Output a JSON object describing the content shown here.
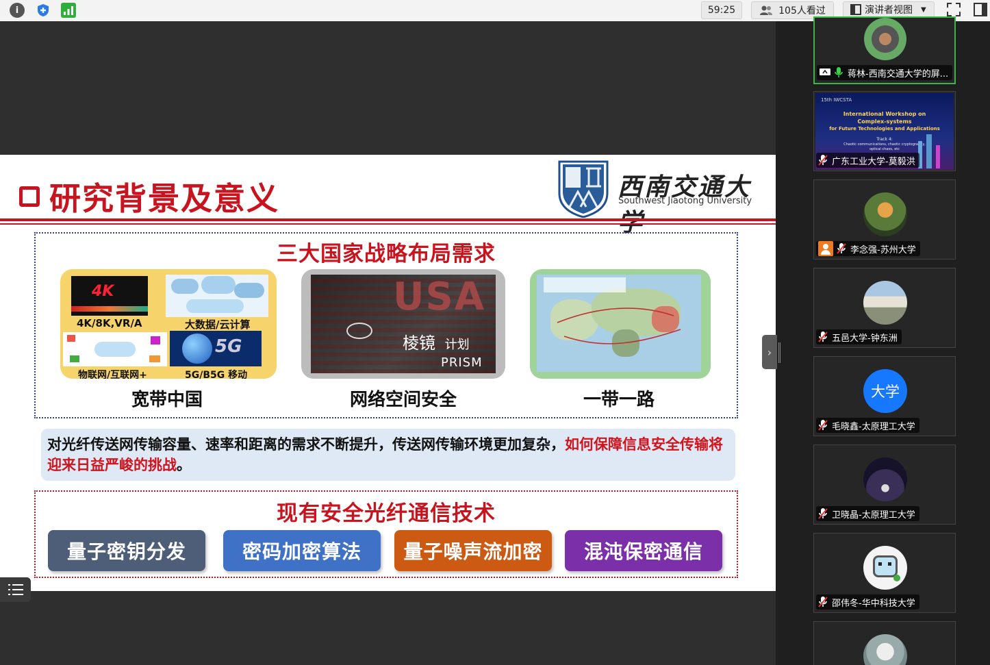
{
  "topbar": {
    "timer": "59:25",
    "viewers": "105人看过",
    "view_mode": "演讲者视图"
  },
  "slide": {
    "title": "研究背景及意义",
    "university_cn": "西南交通大学",
    "university_en": "Southwest Jiaotong University",
    "section1_heading": "三大国家战略布局需求",
    "cards": [
      {
        "label": "宽带中国",
        "sub_labels": [
          "4K/8K,VR/A",
          "大数据/云计算",
          "物联网/互联网+",
          "5G/B5G 移动"
        ]
      },
      {
        "label": "网络空间安全",
        "sub_labels": [
          "USA",
          "棱镜",
          "计划",
          "PRISM"
        ]
      },
      {
        "label": "一带一路"
      }
    ],
    "note_plain": "对光纤传送网传输容量、速率和距离的需求不断提升，传送网传输环境更加复杂，",
    "note_highlight": "如何保障信息安全传输将迎来日益严峻的挑战",
    "note_end": "。",
    "section2_heading": "现有安全光纤通信技术",
    "techs": [
      {
        "label": "量子密钥分发",
        "color": "#4e5d78"
      },
      {
        "label": "密码加密算法",
        "color": "#3f72c7"
      },
      {
        "label": "量子噪声流加密",
        "color": "#cc5a12"
      },
      {
        "label": "混沌保密通信",
        "color": "#7b2fa8"
      }
    ],
    "workshop": {
      "line0": "15th IWCSTA",
      "line1": "International Workshop on",
      "line2": "Complex-systems",
      "line3": "for Future Technologies and Applications",
      "line4": "Track 4:",
      "line5": "Chaotic communications, chaotic cryptography,",
      "line6": "optical chaos, etc"
    }
  },
  "participants": [
    {
      "name": "蒋林-西南交通大学的屏...",
      "status": "speaking"
    },
    {
      "name": "广东工业大学-莫毅洪",
      "status": "muted"
    },
    {
      "name": "李念强-苏州大学",
      "status": "muted"
    },
    {
      "name": "五邑大学-钟东洲",
      "status": "muted"
    },
    {
      "name": "毛晓鑫-太原理工大学",
      "status": "muted",
      "avatar_text": "大学"
    },
    {
      "name": "卫晓晶-太原理工大学",
      "status": "muted"
    },
    {
      "name": "邵伟冬-华中科技大学",
      "status": "muted"
    }
  ]
}
